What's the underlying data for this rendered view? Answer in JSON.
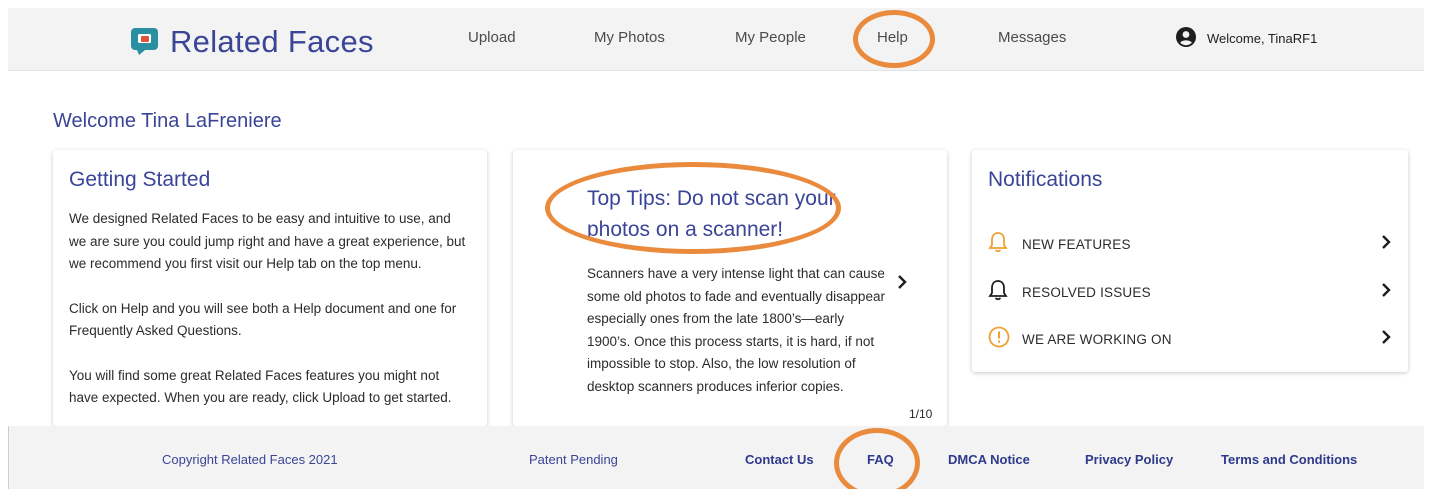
{
  "header": {
    "brand": "Related Faces",
    "nav": [
      "Upload",
      "My Photos",
      "My People",
      "Help",
      "Messages"
    ],
    "welcome": "Welcome, TinaRF1"
  },
  "page": {
    "welcome_title": "Welcome Tina LaFreniere"
  },
  "getting_started": {
    "title": "Getting Started",
    "paragraphs": [
      "We designed Related Faces to be easy and intuitive to use, and we are sure you could jump right and have a great experience, but we recommend you first visit our Help tab on the top menu.",
      "Click on Help and you will see both a Help document and one for Frequently Asked Questions.",
      "You will find some great Related Faces features you might not have expected. When you are ready, click Upload to get started."
    ]
  },
  "tips": {
    "title": "Top Tips: Do not scan your photos on a scanner!",
    "body": "Scanners have a very intense light that can cause some old photos to fade and eventually disappear especially ones from the late 1800’s—early 1900’s. Once this process starts, it is hard, if not impossible to stop. Also, the low resolution of desktop scanners produces inferior copies.",
    "counter": "1/10"
  },
  "notifications": {
    "title": "Notifications",
    "items": [
      {
        "label": "NEW FEATURES",
        "icon": "bell-icon",
        "color": "#f0a030"
      },
      {
        "label": "RESOLVED ISSUES",
        "icon": "bell-icon",
        "color": "#1e1e1e"
      },
      {
        "label": "WE ARE WORKING ON",
        "icon": "alert-circle-icon",
        "color": "#f0a030"
      }
    ]
  },
  "footer": {
    "copyright": "Copyright Related Faces 2021",
    "patent": "Patent Pending",
    "links": [
      "Contact Us",
      "FAQ",
      "DMCA Notice",
      "Privacy Policy",
      "Terms and Conditions"
    ]
  },
  "colors": {
    "brand": "#3a4597",
    "logo_teal": "#2a8fa0",
    "logo_red": "#e0523a",
    "highlight": "#e98a3c"
  }
}
